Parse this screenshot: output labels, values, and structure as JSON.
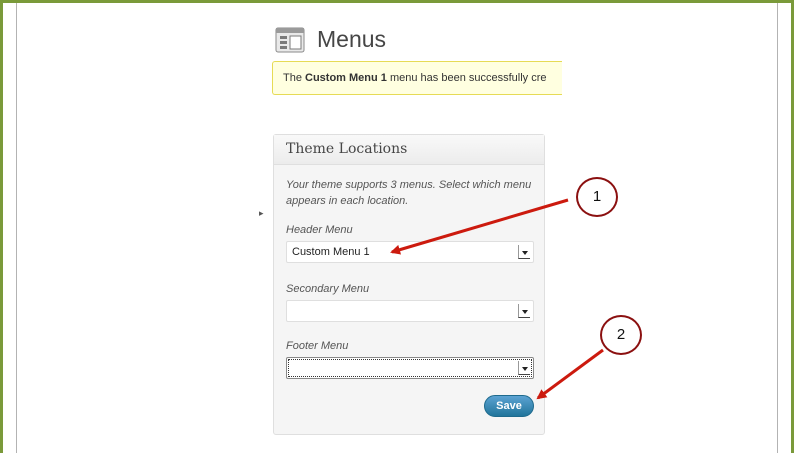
{
  "page": {
    "title": "Menus",
    "page_icon": "menus-page-icon"
  },
  "notice": {
    "prefix": "The ",
    "menu_name": "Custom Menu 1",
    "suffix": " menu has been successfully cre"
  },
  "theme_locations": {
    "heading": "Theme Locations",
    "help_text": "Your theme supports 3 menus. Select which menu appears in each location.",
    "fields": [
      {
        "label": "Header Menu",
        "selected": "Custom Menu 1"
      },
      {
        "label": "Secondary Menu",
        "selected": ""
      },
      {
        "label": "Footer Menu",
        "selected": ""
      }
    ],
    "save_label": "Save"
  },
  "annotations": {
    "callout_1": "1",
    "callout_2": "2",
    "arrow_color": "#cc1a0e"
  },
  "colors": {
    "frame_border": "#7a9a3a",
    "button_blue": "#21759b",
    "notice_bg": "#ffffe0"
  }
}
